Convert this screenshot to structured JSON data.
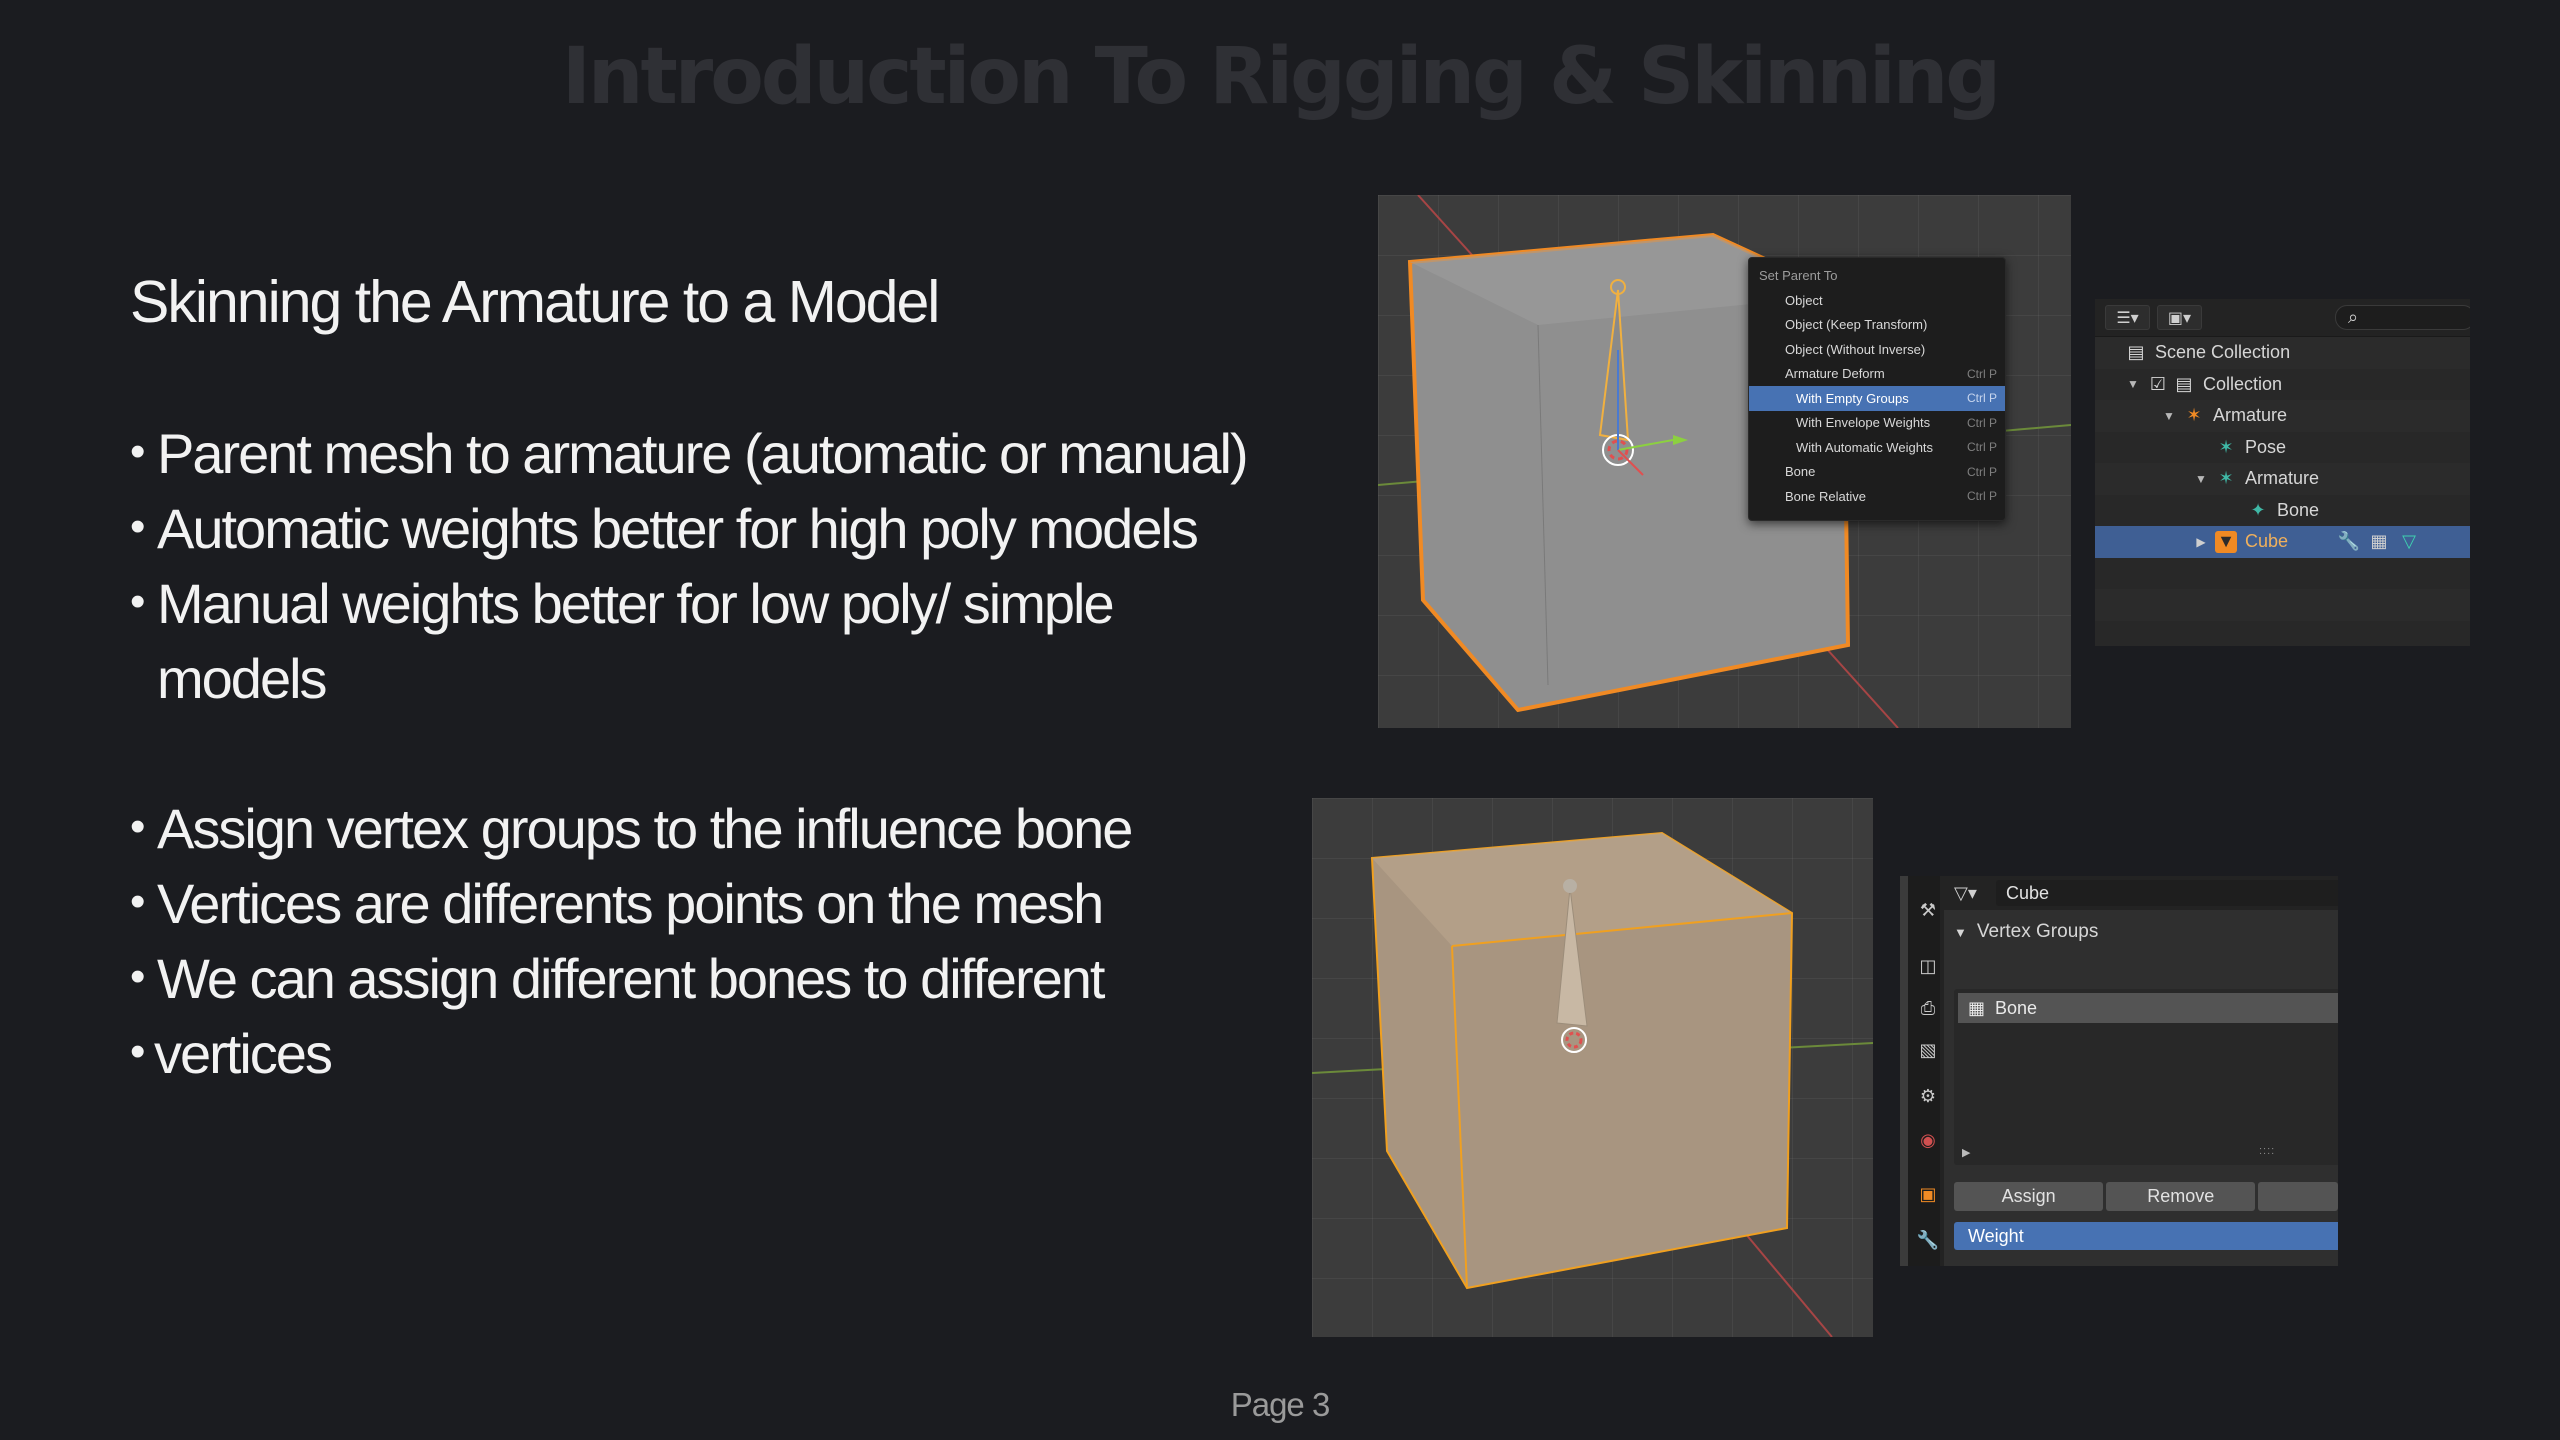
{
  "slide": {
    "title": "Introduction To Rigging & Skinning",
    "subtitle": "Skinning the Armature to a Model",
    "bullets": [
      "Parent mesh to armature (automatic or manual)",
      "Automatic weights better for high poly models",
      "Manual weights better for low poly/ simple models",
      "Assign vertex groups to the influence bone",
      "Vertices are differents points on the mesh",
      "We can assign different bones to different",
      "vertices"
    ],
    "page": "Page 3"
  },
  "parent_menu": {
    "title": "Set Parent To",
    "items": [
      {
        "label": "Object",
        "shortcut": ""
      },
      {
        "label": "Object (Keep Transform)",
        "shortcut": ""
      },
      {
        "label": "Object (Without Inverse)",
        "shortcut": ""
      },
      {
        "label": "Armature Deform",
        "shortcut": "Ctrl P"
      },
      {
        "label": "With Empty Groups",
        "shortcut": "Ctrl P"
      },
      {
        "label": "With Envelope Weights",
        "shortcut": "Ctrl P"
      },
      {
        "label": "With Automatic Weights",
        "shortcut": "Ctrl P"
      },
      {
        "label": "Bone",
        "shortcut": "Ctrl P"
      },
      {
        "label": "Bone Relative",
        "shortcut": "Ctrl P"
      }
    ]
  },
  "outliner": {
    "items": [
      "Scene Collection",
      "Collection",
      "Armature",
      "Pose",
      "Armature",
      "Bone",
      "Cube"
    ]
  },
  "properties": {
    "object_name": "Cube",
    "section": "Vertex Groups",
    "group_item": "Bone",
    "assign_label": "Assign",
    "remove_label": "Remove",
    "weight_label": "Weight"
  },
  "colors": {
    "background": "#1b1c20",
    "selection_blue": "#4772b3",
    "selected_orange": "#f08a24"
  }
}
